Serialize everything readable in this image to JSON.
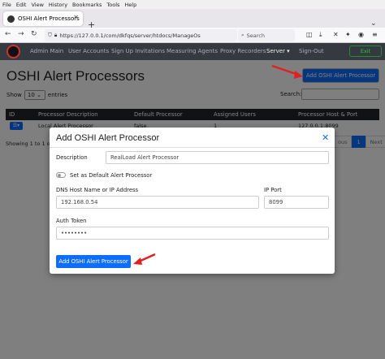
{
  "browser": {
    "menu": [
      "File",
      "Edit",
      "View",
      "History",
      "Bookmarks",
      "Tools",
      "Help"
    ],
    "tab_title": "OSHI Alert Processors",
    "url": "https://127.0.0.1/com/dkfqs/server/htdocs/ManageOs",
    "search_placeholder": "Search"
  },
  "appnav": {
    "items": [
      "Admin Main",
      "User Accounts",
      "Sign Up Invitations",
      "Measuring Agents",
      "Proxy Recorders",
      "Server ▾",
      "Sign-Out"
    ],
    "exit_label": "Exit"
  },
  "page": {
    "title": "OSHI Alert Processors",
    "add_button": "Add OSHI Alert Processor",
    "show_label": "Show",
    "entries_value": "10",
    "entries_label": "entries",
    "search_label": "Search:"
  },
  "table": {
    "headers": [
      "ID",
      "Processor Description",
      "Default Processor",
      "Assigned Users",
      "Processor Host & Port"
    ],
    "row": {
      "description": "Local Alert Processor",
      "default": "false",
      "users": "1",
      "host": "127.0.0.1:8099"
    }
  },
  "footer": {
    "showing": "Showing 1 to 1 o",
    "prev": "ous",
    "page": "1",
    "next": "Next"
  },
  "modal": {
    "title": "Add OSHI Alert Processor",
    "description_label": "Description",
    "description_value": "RealLoad Alert Processor",
    "default_toggle_label": "Set as Default Alert Processor",
    "dns_label": "DNS Host Name or IP Address",
    "dns_value": "192.168.0.54",
    "port_label": "IP Port",
    "port_value": "8099",
    "token_label": "Auth Token",
    "token_value": "••••••••",
    "submit_label": "Add OSHI Alert Processor"
  },
  "colors": {
    "primary": "#0d6efd",
    "navbar": "#343a40",
    "arrow": "#e02020"
  }
}
